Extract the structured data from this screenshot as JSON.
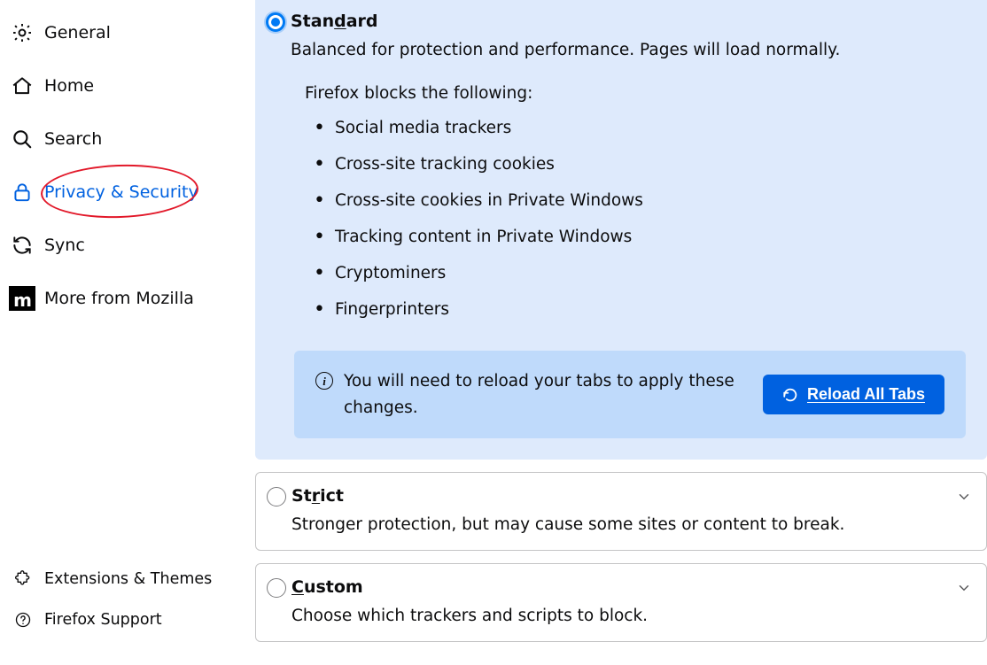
{
  "sidebar": {
    "items": [
      {
        "id": "general",
        "label": "General"
      },
      {
        "id": "home",
        "label": "Home"
      },
      {
        "id": "search",
        "label": "Search"
      },
      {
        "id": "privacy",
        "label": "Privacy & Security"
      },
      {
        "id": "sync",
        "label": "Sync"
      },
      {
        "id": "more",
        "label": "More from Mozilla"
      }
    ],
    "active_id": "privacy",
    "annotation_on": "privacy",
    "footer": [
      {
        "id": "extensions",
        "label": "Extensions & Themes"
      },
      {
        "id": "support",
        "label": "Firefox Support"
      }
    ]
  },
  "tracking_protection": {
    "options": {
      "standard": {
        "title_prefix": "Stan",
        "title_access_key": "d",
        "title_suffix": "ard",
        "description": "Balanced for protection and performance. Pages will load normally.",
        "blocks_heading": "Firefox blocks the following:",
        "blocks": [
          "Social media trackers",
          "Cross-site tracking cookies",
          "Cross-site cookies in Private Windows",
          "Tracking content in Private Windows",
          "Cryptominers",
          "Fingerprinters"
        ],
        "reload_message": "You will need to reload your tabs to apply these changes.",
        "reload_button_prefix": "R",
        "reload_button_rest": "eload All Tabs"
      },
      "strict": {
        "title_prefix": "St",
        "title_access_key": "r",
        "title_suffix": "ict",
        "description": "Stronger protection, but may cause some sites or content to break."
      },
      "custom": {
        "title_prefix": "",
        "title_access_key": "C",
        "title_suffix": "ustom",
        "description": "Choose which trackers and scripts to block."
      }
    },
    "selected": "standard"
  }
}
